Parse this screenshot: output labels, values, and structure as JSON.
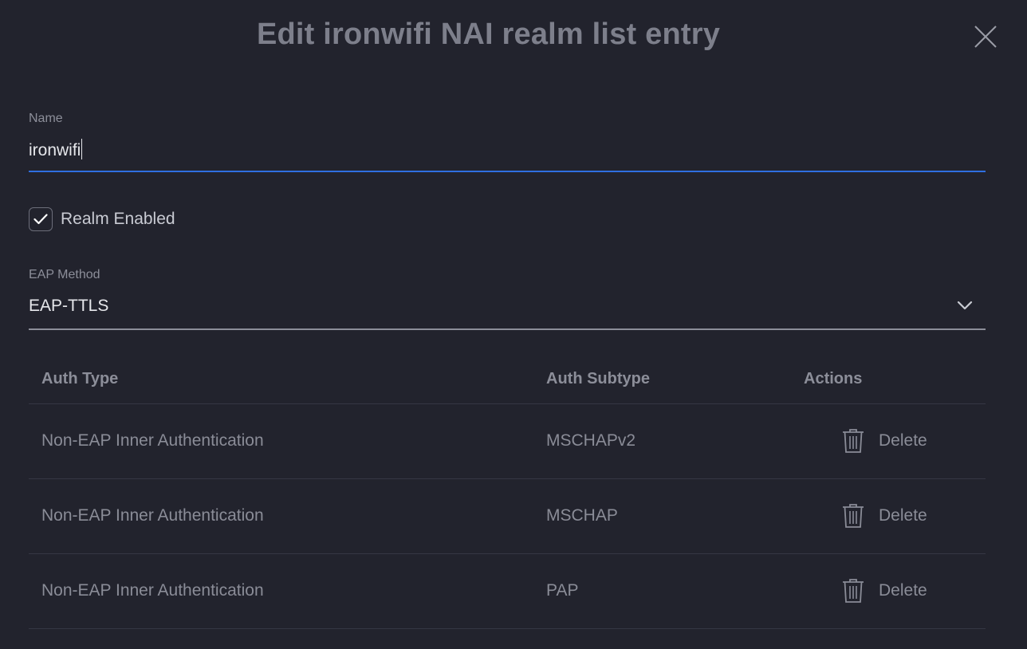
{
  "dialog": {
    "title": "Edit ironwifi NAI realm list entry"
  },
  "name_field": {
    "label": "Name",
    "value": "ironwifi"
  },
  "realm_enabled": {
    "label": "Realm Enabled",
    "checked": true
  },
  "eap_method": {
    "label": "EAP Method",
    "selected": "EAP-TTLS"
  },
  "auth_table": {
    "headers": {
      "auth_type": "Auth Type",
      "auth_subtype": "Auth Subtype",
      "actions": "Actions"
    },
    "rows": [
      {
        "auth_type": "Non-EAP Inner Authentication",
        "auth_subtype": "MSCHAPv2",
        "action": "Delete"
      },
      {
        "auth_type": "Non-EAP Inner Authentication",
        "auth_subtype": "MSCHAP",
        "action": "Delete"
      },
      {
        "auth_type": "Non-EAP Inner Authentication",
        "auth_subtype": "PAP",
        "action": "Delete"
      }
    ]
  },
  "icons": {
    "close": "close-icon",
    "checkbox": "checkmark-icon",
    "dropdown": "chevron-down-icon",
    "delete": "trash-icon"
  },
  "colors": {
    "background": "#22232d",
    "accent": "#2f6fe0",
    "title": "#7d7f8b",
    "muted_text": "#8a8c97"
  }
}
